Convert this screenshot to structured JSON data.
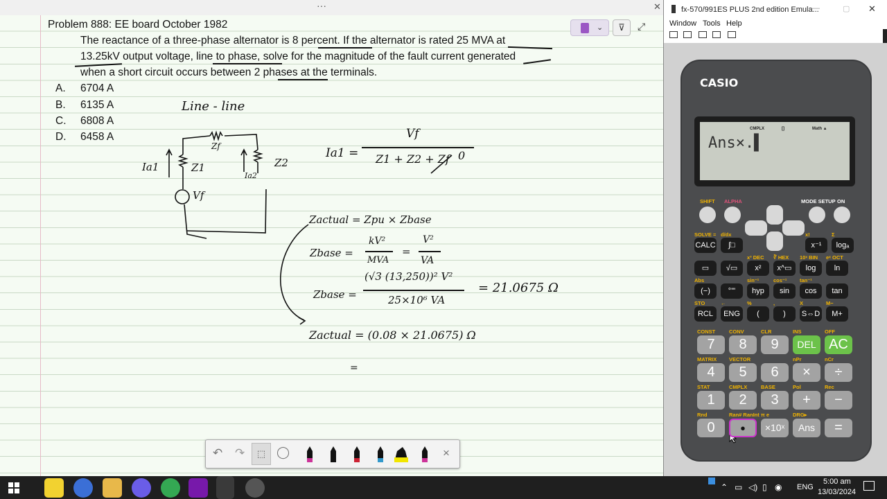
{
  "problem": {
    "title": "Problem 888: EE board October 1982",
    "line1": "The reactance of a three-phase alternator is 8 percent. If the alternator is rated 25 MVA at",
    "line2": "13.25kV output voltage, line to phase, solve for the magnitude of the fault current generated",
    "line3": "when a short circuit occurs between 2 phases at the terminals.",
    "choices": [
      {
        "letter": "A.",
        "value": "6704 A"
      },
      {
        "letter": "B.",
        "value": "6135 A"
      },
      {
        "letter": "C.",
        "value": "6808 A"
      },
      {
        "letter": "D.",
        "value": "6458 A"
      }
    ]
  },
  "handwriting": {
    "heading": "Line - line",
    "zf": "Zf",
    "ia1": "Ia1",
    "z1": "Z1",
    "z2": "Z2",
    "ia2": "Ia2",
    "vf": "Vf",
    "fault_eq_lhs": "Ia1 =",
    "fault_num": "Vf",
    "fault_den": "Z1 + Z2 + Zf",
    "fault_zero": "0",
    "zactual_def": "Zactual = Zpu × Zbase",
    "zbase1_lhs": "Zbase =",
    "zbase1_a_num": "kV²",
    "zbase1_a_den": "MVA",
    "zbase1_eq": "=",
    "zbase1_b_num": "V²",
    "zbase1_b_den": "VA",
    "zbase2_lhs": "Zbase =",
    "zbase2_num": "(√3 (13,250))² V²",
    "zbase2_den": "25×10⁶ VA",
    "zbase2_result": "= 21.0675 Ω",
    "zactual2": "Zactual = (0.08 × 21.0675) Ω",
    "eq_start": "="
  },
  "ink_toolbar": {
    "pens": [
      "#cc3399",
      "#111111",
      "#cc2233",
      "#3399cc",
      "#f2e600",
      "#cc3399"
    ],
    "close": "×"
  },
  "calculator": {
    "window_title": "fx-570/991ES PLUS 2nd edition Emula...",
    "menu": [
      "Window",
      "Tools",
      "Help"
    ],
    "brand": "CASIO",
    "indicators": [
      "CMPLX",
      "[]",
      "Math ▲"
    ],
    "display": "Ans×.▌",
    "top_labels": {
      "shift": "SHIFT",
      "alpha": "ALPHA",
      "mode": "MODE SETUP",
      "on": "ON"
    },
    "func_rows": [
      [
        {
          "k": "CALC",
          "s": "SOLVE ="
        },
        {
          "k": "∫□",
          "s": "d/dx"
        },
        {
          "k": "x⁻¹",
          "s": "x!"
        },
        {
          "k": "logₐ",
          "s": "Σ"
        }
      ],
      [
        {
          "k": "▭",
          "s": ""
        },
        {
          "k": "√▭",
          "s": ""
        },
        {
          "k": "x²",
          "s": "x³ DEC"
        },
        {
          "k": "x^▭",
          "s": "∛ HEX"
        },
        {
          "k": "log",
          "s": "10ˣ BIN"
        },
        {
          "k": "ln",
          "s": "eˣ OCT"
        }
      ],
      [
        {
          "k": "(−)",
          "s": "Abs"
        },
        {
          "k": "°'\"",
          "s": ""
        },
        {
          "k": "hyp",
          "s": "sin⁻¹"
        },
        {
          "k": "sin",
          "s": "cos⁻¹"
        },
        {
          "k": "cos",
          "s": "tan⁻¹"
        },
        {
          "k": "tan",
          "s": ""
        }
      ],
      [
        {
          "k": "RCL",
          "s": "STO"
        },
        {
          "k": "ENG",
          "s": "←"
        },
        {
          "k": "(",
          "s": "%"
        },
        {
          "k": ")",
          "s": ","
        },
        {
          "k": "S⇔D",
          "s": "X"
        },
        {
          "k": "M+",
          "s": "M−"
        }
      ]
    ],
    "num_rows": [
      [
        {
          "k": "7",
          "s": "CONST"
        },
        {
          "k": "8",
          "s": "CONV"
        },
        {
          "k": "9",
          "s": "CLR"
        },
        {
          "k": "DEL",
          "s": "INS"
        },
        {
          "k": "AC",
          "s": "OFF"
        }
      ],
      [
        {
          "k": "4",
          "s": "MATRIX"
        },
        {
          "k": "5",
          "s": "VECTOR"
        },
        {
          "k": "6",
          "s": ""
        },
        {
          "k": "×",
          "s": "nPr"
        },
        {
          "k": "÷",
          "s": "nCr"
        }
      ],
      [
        {
          "k": "1",
          "s": "STAT"
        },
        {
          "k": "2",
          "s": "CMPLX"
        },
        {
          "k": "3",
          "s": "BASE"
        },
        {
          "k": "+",
          "s": "Pol"
        },
        {
          "k": "−",
          "s": "Rec"
        }
      ],
      [
        {
          "k": "0",
          "s": "Rnd"
        },
        {
          "k": "•",
          "s": "Ran# RanInt"
        },
        {
          "k": "×10ˣ",
          "s": "π e"
        },
        {
          "k": "Ans",
          "s": "DRG▸"
        },
        {
          "k": "=",
          "s": ""
        }
      ]
    ]
  },
  "taskbar": {
    "lang": "ENG",
    "time": "5:00 am",
    "date": "13/03/2024"
  }
}
